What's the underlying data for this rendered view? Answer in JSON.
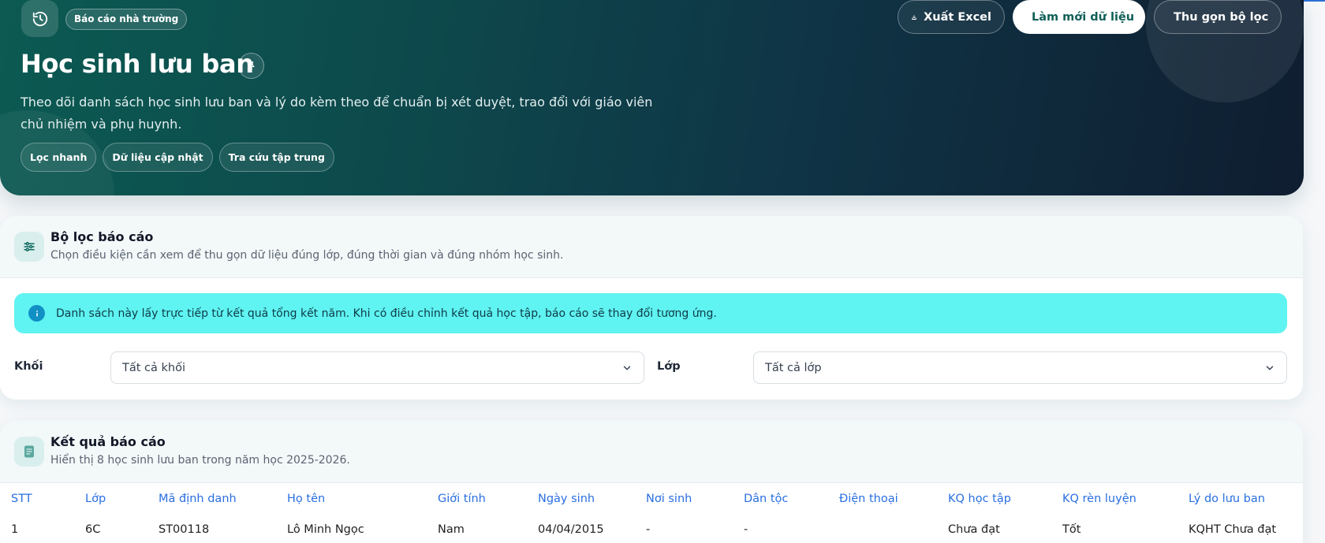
{
  "hero": {
    "chip": "Báo cáo nhà trường",
    "title": "Học sinh lưu ban",
    "description": "Theo dõi danh sách học sinh lưu ban và lý do kèm theo để chuẩn bị xét duyệt, trao đổi với giáo viên chủ nhiệm và phụ huynh.",
    "tags": [
      "Lọc nhanh",
      "Dữ liệu cập nhật",
      "Tra cứu tập trung"
    ],
    "buttons": {
      "export": "Xuất Excel",
      "refresh": "Làm mới dữ liệu",
      "collapse": "Thu gọn bộ lọc"
    }
  },
  "filter": {
    "title": "Bộ lọc báo cáo",
    "subtitle": "Chọn điều kiện cần xem để thu gọn dữ liệu đúng lớp, đúng thời gian và đúng nhóm học sinh.",
    "notice": "Danh sách này lấy trực tiếp từ kết quả tổng kết năm. Khi có điều chỉnh kết quả học tập, báo cáo sẽ thay đổi tương ứng.",
    "grade_label": "Khối",
    "grade_value": "Tất cả khối",
    "class_label": "Lớp",
    "class_value": "Tất cả lớp"
  },
  "results": {
    "title": "Kết quả báo cáo",
    "subtitle": "Hiển thị 8 học sinh lưu ban trong năm học 2025-2026.",
    "columns": [
      "STT",
      "Lớp",
      "Mã định danh",
      "Họ tên",
      "Giới tính",
      "Ngày sinh",
      "Nơi sinh",
      "Dân tộc",
      "Điện thoại",
      "KQ học tập",
      "KQ rèn luyện",
      "Lý do lưu ban"
    ],
    "rows": [
      [
        "1",
        "6C",
        "ST00118",
        "Lô Minh Ngọc",
        "Nam",
        "04/04/2015",
        "-",
        "-",
        "",
        "Chưa đạt",
        "Tốt",
        "KQHT Chưa đạt"
      ]
    ]
  }
}
